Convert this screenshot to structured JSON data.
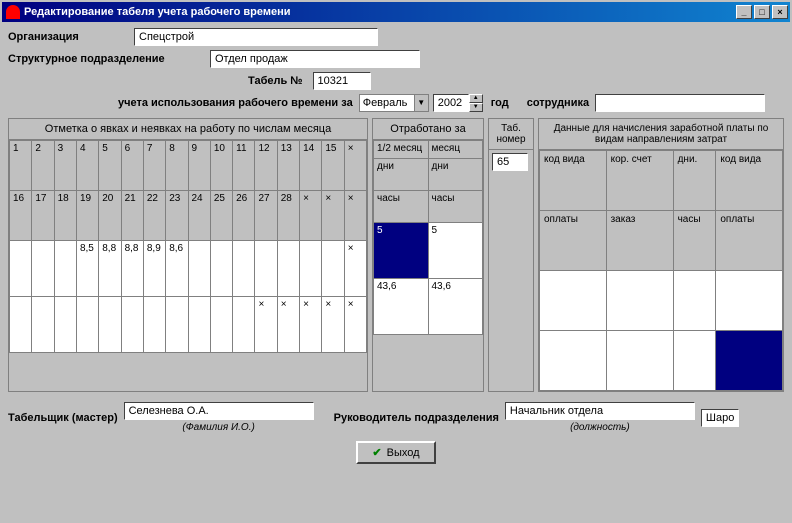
{
  "titlebar": {
    "title": "Редактирование табеля учета рабочего времени"
  },
  "icons": {
    "minimize": "_",
    "maximize": "□",
    "close": "×"
  },
  "form": {
    "org_label": "Организация",
    "org_value": "Спецстрой",
    "dept_label": "Структурное подразделение",
    "dept_value": "Отдел продаж",
    "tabel_no_label": "Табель №",
    "tabel_no_value": "10321",
    "period_label": "учета использования рабочего времени за",
    "month_value": "Февраль",
    "year_value": "2002",
    "year_label": "год",
    "employee_label": "сотрудника",
    "employee_value": ""
  },
  "attendance": {
    "header": "Отметка о явках и неявках на работу по числам месяца",
    "row1": [
      "1",
      "2",
      "3",
      "4",
      "5",
      "6",
      "7",
      "8",
      "9",
      "10",
      "11",
      "12",
      "13",
      "14",
      "15",
      "×"
    ],
    "row2": [
      "16",
      "17",
      "18",
      "19",
      "20",
      "21",
      "22",
      "23",
      "24",
      "25",
      "26",
      "27",
      "28",
      "×",
      "×",
      "×"
    ],
    "val1": [
      "",
      "",
      "",
      "8,5",
      "8,8",
      "8,8",
      "8,9",
      "8,6",
      "",
      "",
      "",
      "",
      "",
      "",
      "",
      "×"
    ],
    "val2": [
      "",
      "",
      "",
      "",
      "",
      "",
      "",
      "",
      "",
      "",
      "",
      "×",
      "×",
      "×",
      "×",
      "×"
    ]
  },
  "worked": {
    "header": "Отработано за",
    "half_label": "1/2 месяц",
    "month_label": "месяц",
    "days_label": "дни",
    "hours_label": "часы",
    "days_half": "5",
    "days_full": "5",
    "hours_half": "43,6",
    "hours_full": "43,6"
  },
  "tabno": {
    "header": "Таб. номер",
    "value": "65"
  },
  "payroll": {
    "header": "Данные для начисления заработной платы по видам направлениям затрат",
    "r1": [
      "код вида",
      "кор. счет",
      "дни.",
      "код вида"
    ],
    "r2": [
      "оплаты",
      "заказ",
      "часы",
      "оплаты"
    ]
  },
  "signatures": {
    "timekeeper_label": "Табельщик (мастер)",
    "timekeeper_value": "Селезнева О.А.",
    "timekeeper_hint": "(Фамилия И.О.)",
    "supervisor_label": "Руководитель подразделения",
    "supervisor_value": "Начальник отдела",
    "supervisor_hint": "(должность)",
    "supervisor_name": "Шаро"
  },
  "exit_label": "Выход"
}
